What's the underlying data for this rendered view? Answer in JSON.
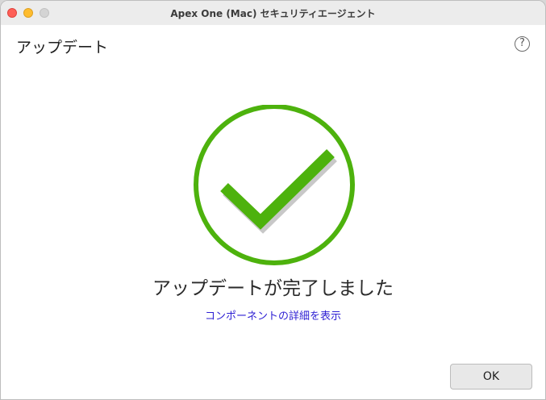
{
  "window": {
    "title": "Apex One (Mac) セキュリティエージェント"
  },
  "header": {
    "title": "アップデート",
    "help_icon": "question-mark-circle-icon",
    "help_glyph": "?"
  },
  "main": {
    "status_icon": "checkmark-circle-icon",
    "status_color": "#4db20d",
    "message": "アップデートが完了しました",
    "details_link": "コンポーネントの詳細を表示"
  },
  "footer": {
    "ok_label": "OK"
  }
}
